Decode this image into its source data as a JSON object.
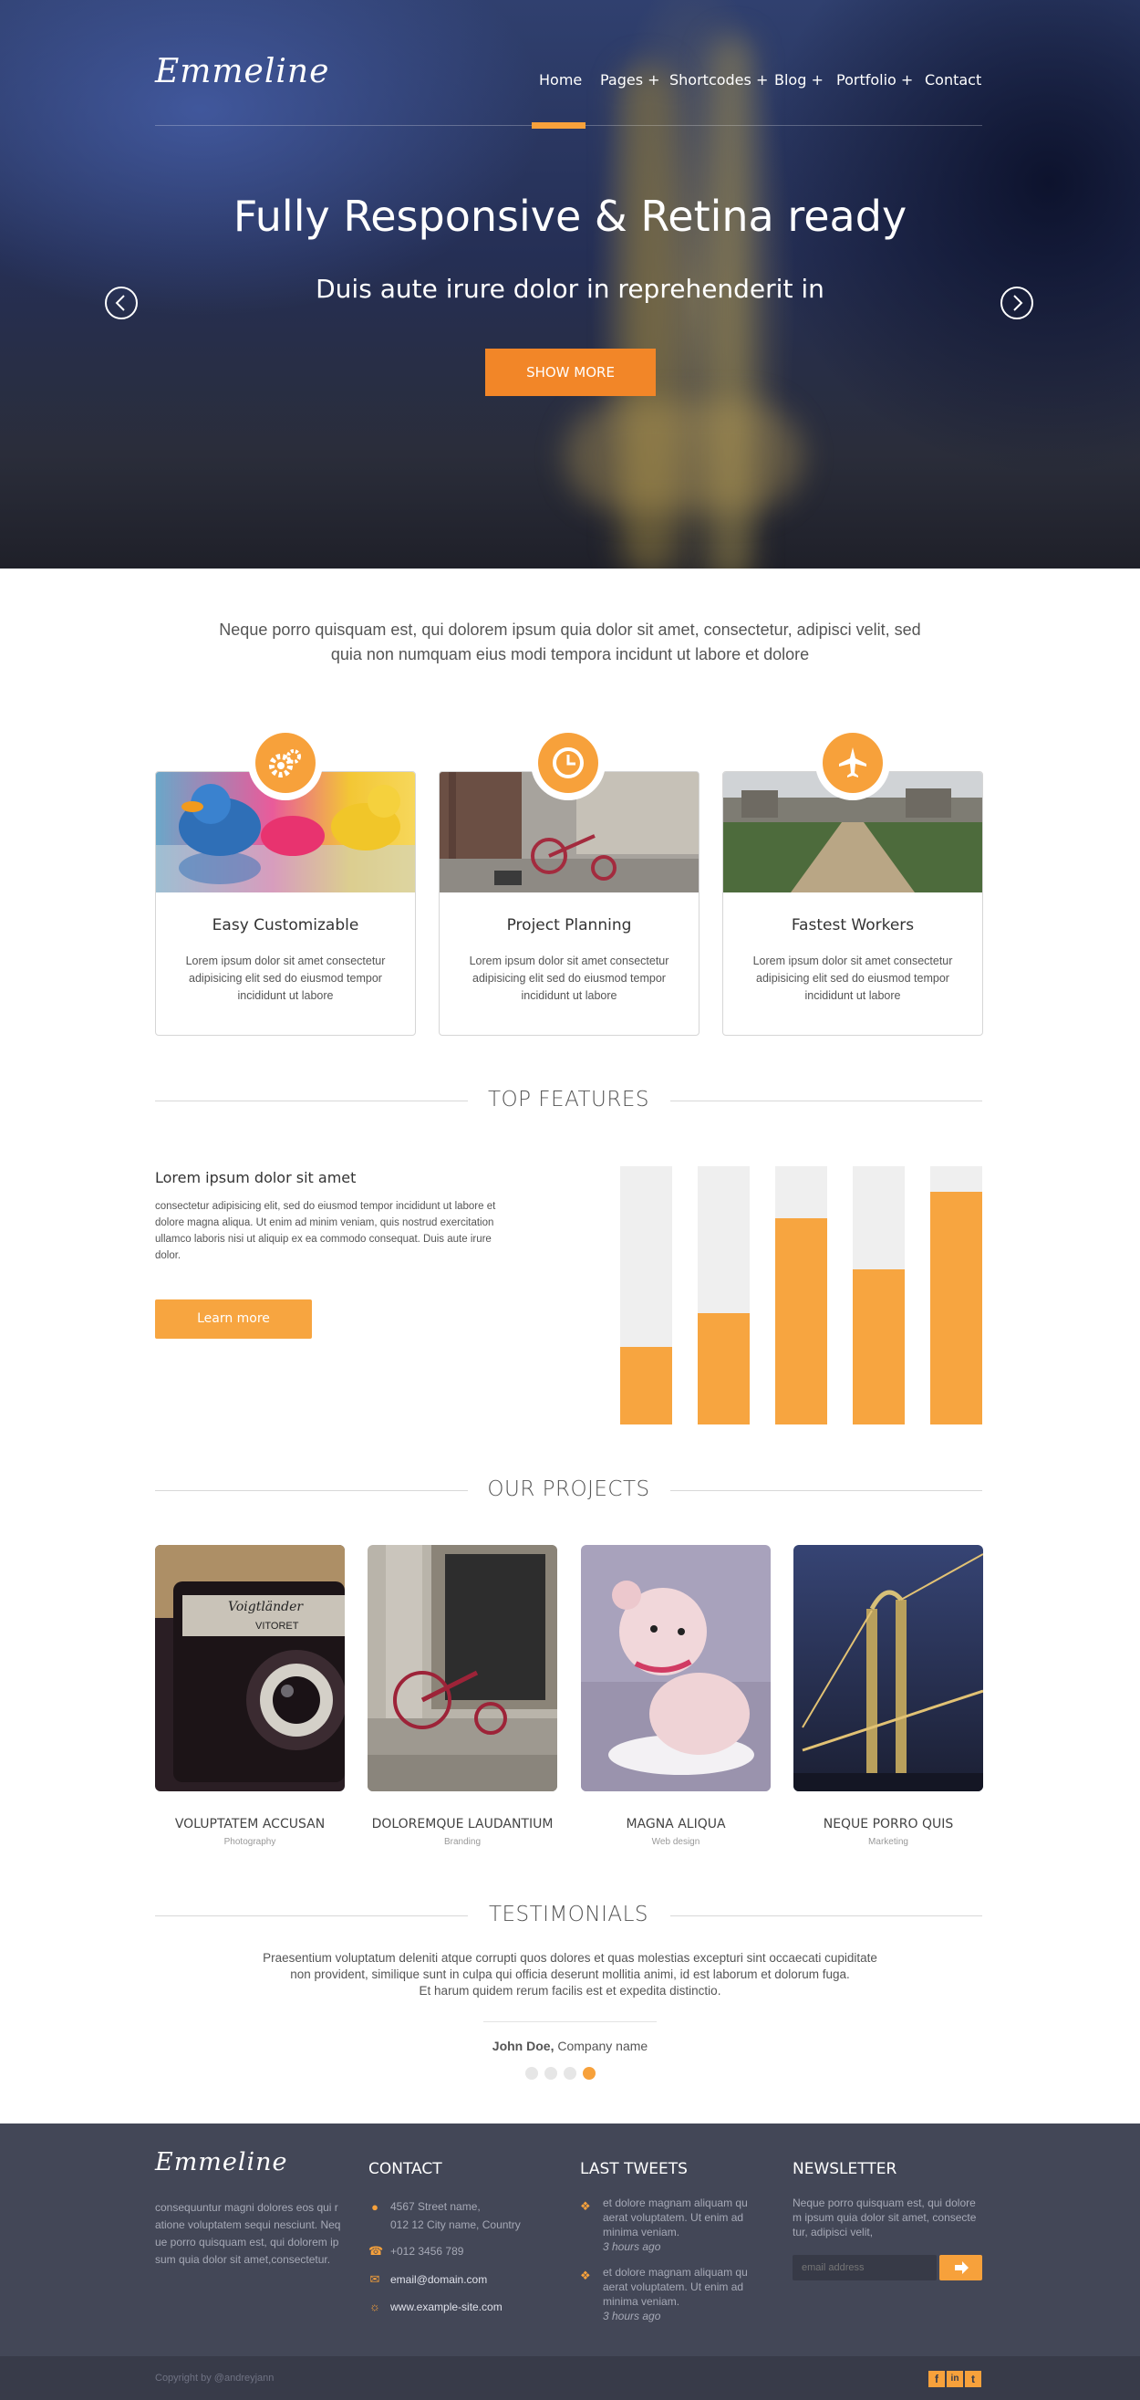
{
  "brand": {
    "logo": "Emmeline",
    "accent": "#f7a13b"
  },
  "nav": {
    "items": [
      "Home",
      "Pages +",
      "Shortcodes +",
      "Blog +",
      "Portfolio +",
      "Contact"
    ],
    "active": "Home"
  },
  "hero": {
    "title": "Fully Responsive & Retina ready",
    "subtitle": "Duis aute irure dolor in reprehenderit in",
    "button": "SHOW MORE",
    "prev_icon": "chevron-left-icon",
    "next_icon": "chevron-right-icon"
  },
  "intro": {
    "line1": "Neque porro quisquam est, qui dolorem ipsum quia dolor sit amet, consectetur, adipisci velit, sed",
    "line2": "quia non numquam eius modi tempora incidunt ut labore et dolore"
  },
  "services": [
    {
      "icon": "gears-icon",
      "title": "Easy Customizable",
      "text": "Lorem ipsum dolor sit amet consectetur adipisicing elit sed do eiusmod tempor incididunt ut labore"
    },
    {
      "icon": "clock-icon",
      "title": "Project Planning",
      "text": "Lorem ipsum dolor sit amet consectetur adipisicing elit sed do eiusmod tempor incididunt ut labore"
    },
    {
      "icon": "airplane-icon",
      "title": "Fastest Workers",
      "text": "Lorem ipsum dolor sit amet consectetur adipisicing elit sed do eiusmod tempor incididunt ut labore"
    }
  ],
  "features": {
    "heading": "TOP FEATURES",
    "title": "Lorem ipsum dolor sit amet",
    "text": "consectetur adipisicing elit, sed do eiusmod tempor incididunt ut labore et dolore magna aliqua. Ut enim ad minim veniam, quis nostrud exercitation ullamco laboris nisi ut aliquip ex ea commodo consequat. Duis aute irure dolor.",
    "button": "Learn more",
    "bars": [
      0.3,
      0.43,
      0.8,
      0.6,
      0.9
    ]
  },
  "projects": {
    "heading": "OUR PROJECTS",
    "items": [
      {
        "title": "VOLUPTATEM ACCUSAN",
        "category": "Photography",
        "image_label": "Voigtländer",
        "image_sub": "VITORET"
      },
      {
        "title": "DOLOREMQUE LAUDANTIUM",
        "category": "Branding"
      },
      {
        "title": "MAGNA ALIQUA",
        "category": "Web design"
      },
      {
        "title": "NEQUE PORRO QUIS",
        "category": "Marketing"
      }
    ]
  },
  "testimonials": {
    "heading": "TESTIMONIALS",
    "line1": "Praesentium voluptatum deleniti atque corrupti quos dolores et quas molestias excepturi sint occaecati cupiditate",
    "line2": "non provident, similique sunt in culpa qui officia deserunt mollitia animi, id est laborum et dolorum fuga.",
    "line3": "Et harum quidem rerum facilis est et expedita distinctio.",
    "author": "John Doe,",
    "company": "Company name",
    "active_dot": 4
  },
  "footer": {
    "about": "consequuntur magni dolores eos qui ratione voluptatem sequi nesciunt. Neque porro quisquam est, qui dolorem ipsum quia dolor sit amet,consectetur.",
    "about_lines": [
      "consequuntur magni dolores eos qui r",
      "atione voluptatem sequi nesciunt. Neq",
      "ue porro quisquam est, qui dolorem ip",
      "sum quia dolor sit amet,consectetur."
    ],
    "contact_heading": "CONTACT",
    "address1": "4567 Street name,",
    "address2": "012 12 City name, Country",
    "phone": "+012 3456 789",
    "email": "email@domain.com",
    "website": "www.example-site.com",
    "tweets_heading": "LAST TWEETS",
    "tweets": [
      {
        "lines": [
          "et dolore magnam aliquam qu",
          "aerat voluptatem. Ut enim ad",
          "minima veniam."
        ],
        "time": "3 hours ago"
      },
      {
        "lines": [
          "et dolore magnam aliquam qu",
          "aerat voluptatem. Ut enim ad",
          "minima veniam."
        ],
        "time": "3 hours ago"
      }
    ],
    "newsletter_heading": "NEWSLETTER",
    "newsletter_lines": [
      "Neque porro quisquam est, qui dolore",
      "m ipsum quia dolor sit amet, consecte",
      "tur, adipisci velit,"
    ],
    "newsletter_placeholder": "email address",
    "copyright": "Copyright by @andreyjann",
    "social": [
      "f",
      "in",
      "t"
    ]
  }
}
